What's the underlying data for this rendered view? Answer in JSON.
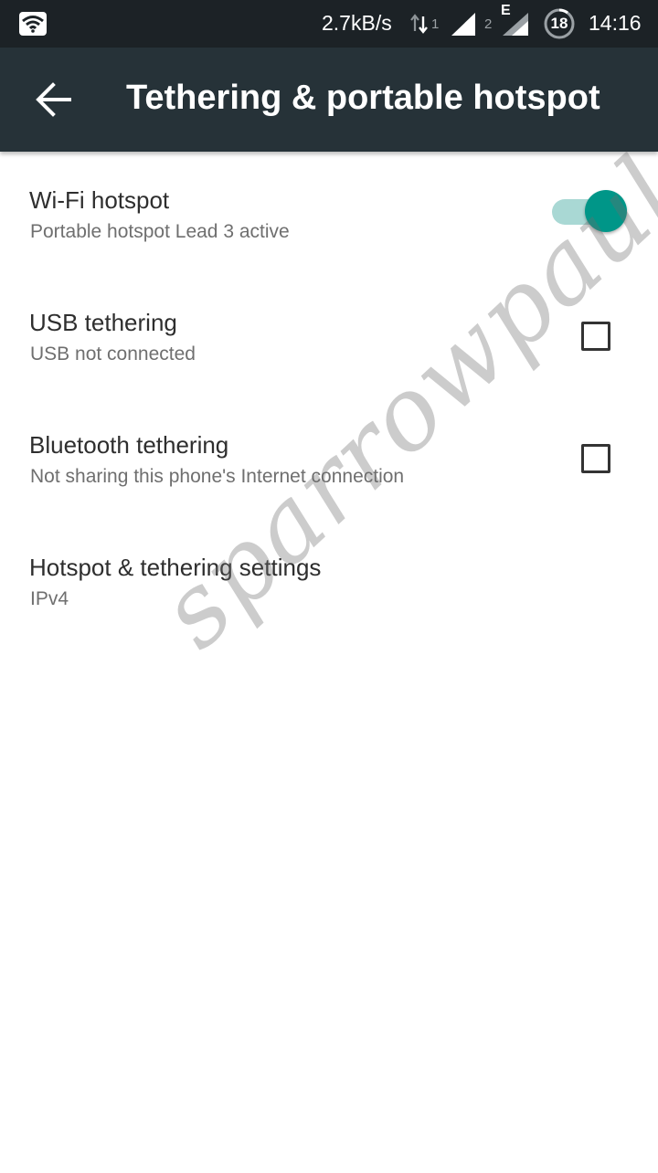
{
  "status_bar": {
    "speed": "2.7kB/s",
    "sim1": "1",
    "sim2": "2",
    "network_type": "E",
    "battery": "18",
    "time": "14:16",
    "icons": [
      "hotspot-icon",
      "data-arrows-icon",
      "signal-icon",
      "signal-edge-icon",
      "battery-icon"
    ]
  },
  "app_bar": {
    "back_icon": "arrow-back-icon",
    "title": "Tethering & portable hotspot",
    "color": "#263238"
  },
  "items": [
    {
      "title": "Wi-Fi hotspot",
      "subtitle": "Portable hotspot Lead 3 active",
      "control": "switch",
      "checked": true
    },
    {
      "title": "USB tethering",
      "subtitle": "USB not connected",
      "control": "checkbox",
      "checked": false
    },
    {
      "title": "Bluetooth tethering",
      "subtitle": "Not sharing this phone's Internet connection",
      "control": "checkbox",
      "checked": false
    },
    {
      "title": "Hotspot & tethering settings",
      "subtitle": "IPv4",
      "control": "none"
    }
  ],
  "accent_color": "#009688",
  "watermark": "sparrowpaul.tk"
}
